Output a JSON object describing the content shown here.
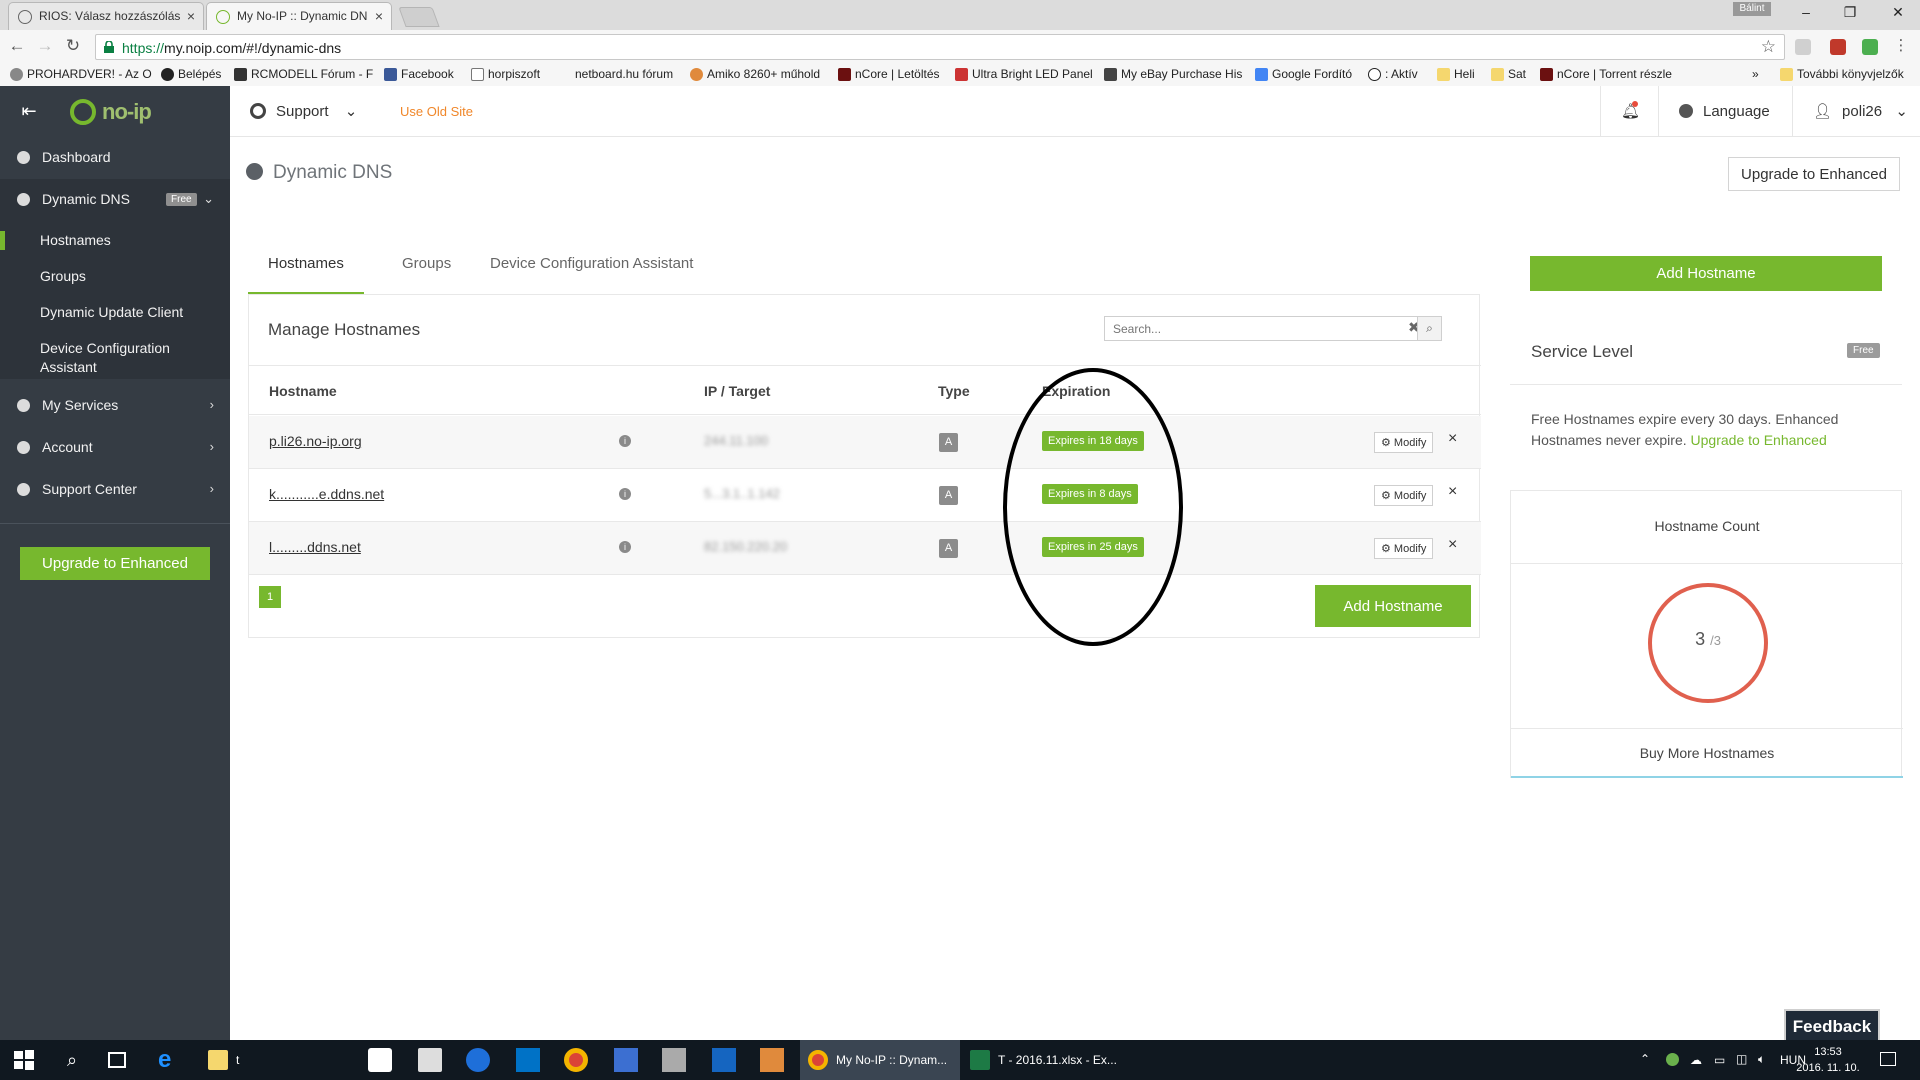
{
  "browser": {
    "tabs": [
      {
        "title": "RIOS: Válasz hozzászólás",
        "active": false
      },
      {
        "title": "My No-IP :: Dynamic DN",
        "active": true
      }
    ],
    "profile_name": "Bálint",
    "url_proto": "https://",
    "url_rest": "my.noip.com/#!/dynamic-dns",
    "bookmarks": [
      "PROHARDVER! - Az O",
      "Belépés",
      "RCMODELL Fórum - F",
      "Facebook",
      "horpiszoft",
      "netboard.hu fórum",
      "Amiko 8260+ műhold",
      "nCore | Letöltés",
      "Ultra Bright LED Panel",
      "My eBay Purchase His",
      "Google Fordító",
      ": Aktív",
      "Heli",
      "Sat",
      "nCore | Torrent részle",
      "További könyvjelzők"
    ]
  },
  "header": {
    "logo": "no-ip",
    "support": "Support",
    "old_site": "Use Old Site",
    "language": "Language",
    "user": "poli26"
  },
  "sidebar": {
    "dashboard": "Dashboard",
    "dynamic_dns": "Dynamic DNS",
    "dynamic_dns_badge": "Free",
    "sub_items": [
      "Hostnames",
      "Groups",
      "Dynamic Update Client",
      "Device Configuration Assistant"
    ],
    "my_services": "My Services",
    "account": "Account",
    "support_center": "Support Center",
    "upgrade": "Upgrade to Enhanced"
  },
  "page": {
    "title": "Dynamic DNS",
    "upgrade_button": "Upgrade to Enhanced",
    "tabs": [
      "Hostnames",
      "Groups",
      "Device Configuration Assistant"
    ],
    "panel_title": "Manage Hostnames",
    "search_placeholder": "Search...",
    "columns": {
      "hostname": "Hostname",
      "ip": "IP / Target",
      "type": "Type",
      "expiration": "Expiration"
    },
    "rows": [
      {
        "hostname": "p.li26.no-ip.org",
        "ip": "244.11.100",
        "type": "A",
        "expiration": "Expires in 18 days",
        "modify": "Modify"
      },
      {
        "hostname": "k...........e.ddns.net",
        "ip": "5...3.1..1.142",
        "type": "A",
        "expiration": "Expires in 8 days",
        "modify": "Modify"
      },
      {
        "hostname": "l.........ddns.net",
        "ip": "82.150.220.20",
        "type": "A",
        "expiration": "Expires in 25 days",
        "modify": "Modify"
      }
    ],
    "page_number": "1",
    "add_hostname": "Add Hostname"
  },
  "right": {
    "add_hostname": "Add Hostname",
    "service_level": "Service Level",
    "service_badge": "Free",
    "service_text": "Free Hostnames expire every 30 days. Enhanced Hostnames never expire.",
    "service_link": "Upgrade to Enhanced",
    "count_title": "Hostname Count",
    "count_used": "3",
    "count_total": "/3",
    "buy_more": "Buy More Hostnames"
  },
  "feedback": "Feedback",
  "taskbar": {
    "folder_label": "t",
    "chrome_app": "My No-IP :: Dynam...",
    "excel_app": "T - 2016.11.xlsx - Ex...",
    "lang": "HUN",
    "time": "13:53",
    "date": "2016. 11. 10."
  },
  "colors": {
    "accent": "#77b82e",
    "sidebar": "#353c44",
    "old_site": "#f0872a",
    "count_ring": "#e0604e"
  }
}
